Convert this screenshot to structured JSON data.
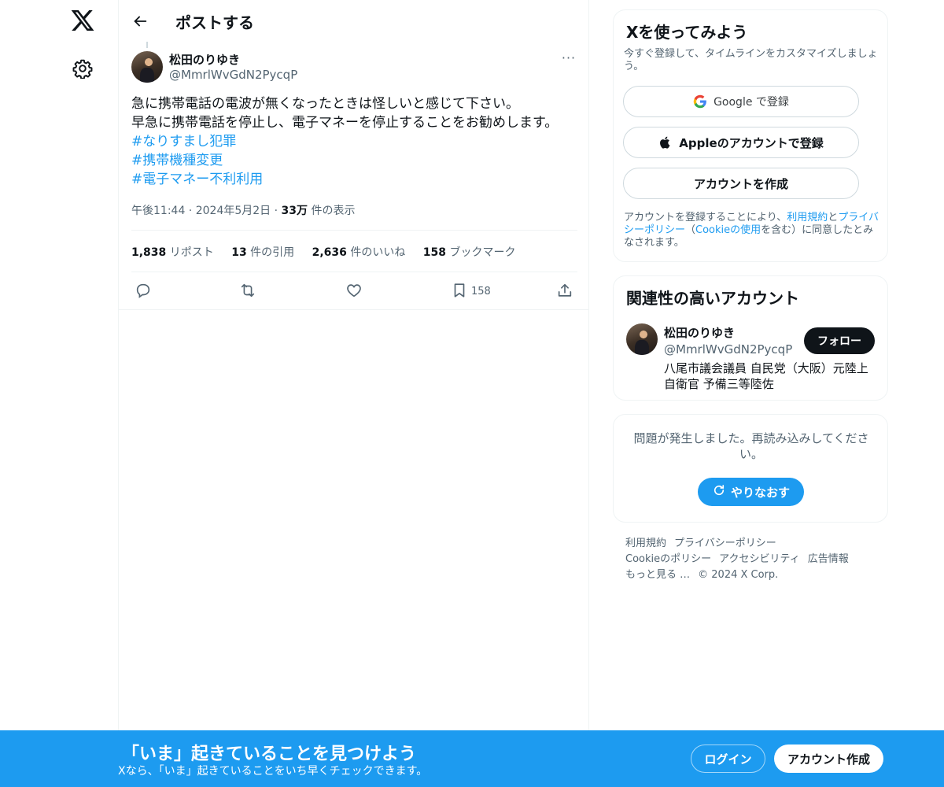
{
  "header": {
    "title": "ポストする"
  },
  "tweet": {
    "author_name": "松田のりゆき",
    "author_handle": "@MmrlWvGdN2PycqP",
    "more": "···",
    "text_line_1": "急に携帯電話の電波が無くなったときは怪しいと感じて下さい。",
    "text_line_2": "早急に携帯電話を停止し、電子マネーを停止することをお勧めします。",
    "hashtags": [
      "#なりすまし犯罪",
      "#携帯機種変更",
      "#電子マネー不利利用"
    ],
    "time": "午後11:44",
    "date": "2024年5月2日",
    "views_count": "33万",
    "views_label": " 件の表示",
    "separator": " · ",
    "stats": [
      {
        "value": "1,838",
        "label": " リポスト"
      },
      {
        "value": "13",
        "label": " 件の引用"
      },
      {
        "value": "2,636",
        "label": " 件のいいね"
      },
      {
        "value": "158",
        "label": " ブックマーク"
      }
    ],
    "bookmark_count": "158"
  },
  "signup_card": {
    "title": "Xを使ってみよう",
    "subtitle": "今すぐ登録して、タイムラインをカスタマイズしましょう。",
    "google_label": "Google で登録",
    "apple_label": "Appleのアカウントで登録",
    "create_label": "アカウントを作成",
    "terms_prefix": "アカウントを登録することにより、",
    "terms_link": "利用規約",
    "terms_and": "と",
    "privacy_link": "プライバシーポリシー",
    "cookie_open": "（",
    "cookie_link": "Cookieの使用",
    "terms_suffix": "を含む）に同意したとみなされます。"
  },
  "related_card": {
    "title": "関連性の高いアカウント",
    "name": "松田のりゆき",
    "handle": "@MmrlWvGdN2PycqP",
    "follow_label": "フォロー",
    "bio": "八尾市議会議員 自民党（大阪）元陸上自衛官 予備三等陸佐"
  },
  "error_card": {
    "message": "問題が発生しました。再読み込みしてください。",
    "retry_label": "やりなおす"
  },
  "footer": {
    "links": [
      "利用規約",
      "プライバシーポリシー",
      "Cookieのポリシー",
      "アクセシビリティ",
      "広告情報",
      "もっと見る …",
      "© 2024 X Corp."
    ]
  },
  "bottom_bar": {
    "title": "「いま」起きていることを見つけよう",
    "subtitle": "Xなら、「いま」起きていることをいち早くチェックできます。",
    "login_label": "ログイン",
    "signup_label": "アカウント作成"
  },
  "colors": {
    "accent": "#1d9bf0",
    "text": "#0f1419",
    "secondary": "#536471",
    "border": "#eff3f4"
  }
}
